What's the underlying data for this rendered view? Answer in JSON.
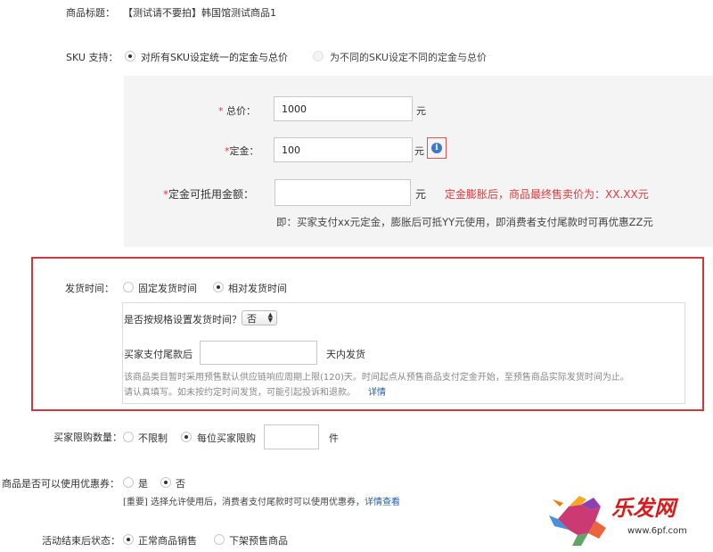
{
  "product_title": {
    "label": "商品标题：",
    "value": "【测试请不要拍】韩国馆测试商品1"
  },
  "sku_support": {
    "label": "SKU 支持：",
    "option_unified": "对所有SKU设定统一的定金与总价",
    "option_different": "为不同的SKU设定不同的定金与总价"
  },
  "pricing": {
    "total_label_star": "* ",
    "total_label": "总价：",
    "total_value": "1000",
    "total_unit": "元",
    "deposit_label_star": "*",
    "deposit_label": "定金：",
    "deposit_value": "100",
    "deposit_unit": "元",
    "info_glyph": "i",
    "offset_label_star": "*",
    "offset_label": "定金可抵用金额：",
    "offset_value": "",
    "offset_unit": "元",
    "offset_final_price": "定金膨胀后，商品最终售卖价为：XX.XX元",
    "offset_hint": "即：买家支付xx元定金，膨胀后可抵YY元使用，即消费者支付尾款时可再优惠ZZ元"
  },
  "shipping": {
    "label": "发货时间：",
    "option_fixed": "固定发货时间",
    "option_relative": "相对发货时间",
    "by_spec_label": "是否按规格设置发货时间？",
    "by_spec_value": "否",
    "after_final_label": "买家支付尾款后",
    "days_value": "",
    "days_suffix": "天内发货",
    "note_line1": "该商品类目暂时采用预售默认供应链响应周期上限(120)天。时间起点从预售商品支付定金开始，至预售商品实际发货时间为止。",
    "note_line2": "请认真填写。如未按约定时间发货，可能引起投诉和退款。",
    "details_link": "详情"
  },
  "purchase_limit": {
    "label": "买家限购数量：",
    "option_unlimited": "不限制",
    "option_per_buyer": "每位买家限购",
    "value": "",
    "unit": "件"
  },
  "coupon": {
    "label": "商品是否可以使用优惠券：",
    "option_yes": "是",
    "option_no": "否",
    "note": "[重要] 选择允许使用后，消费者支付尾款时可以使用优惠券，",
    "note_link": "详情查看"
  },
  "after_event": {
    "label": "活动结束后状态：",
    "option_normal": "正常商品销售",
    "option_delist": "下架预售商品"
  },
  "watermark": {
    "brand": "乐发网",
    "url": "www.6pf.com"
  },
  "colors": {
    "required": "#e4393c",
    "link": "#1f5ea8",
    "highlight_border": "#d3363b",
    "info": "#3f78c8"
  }
}
